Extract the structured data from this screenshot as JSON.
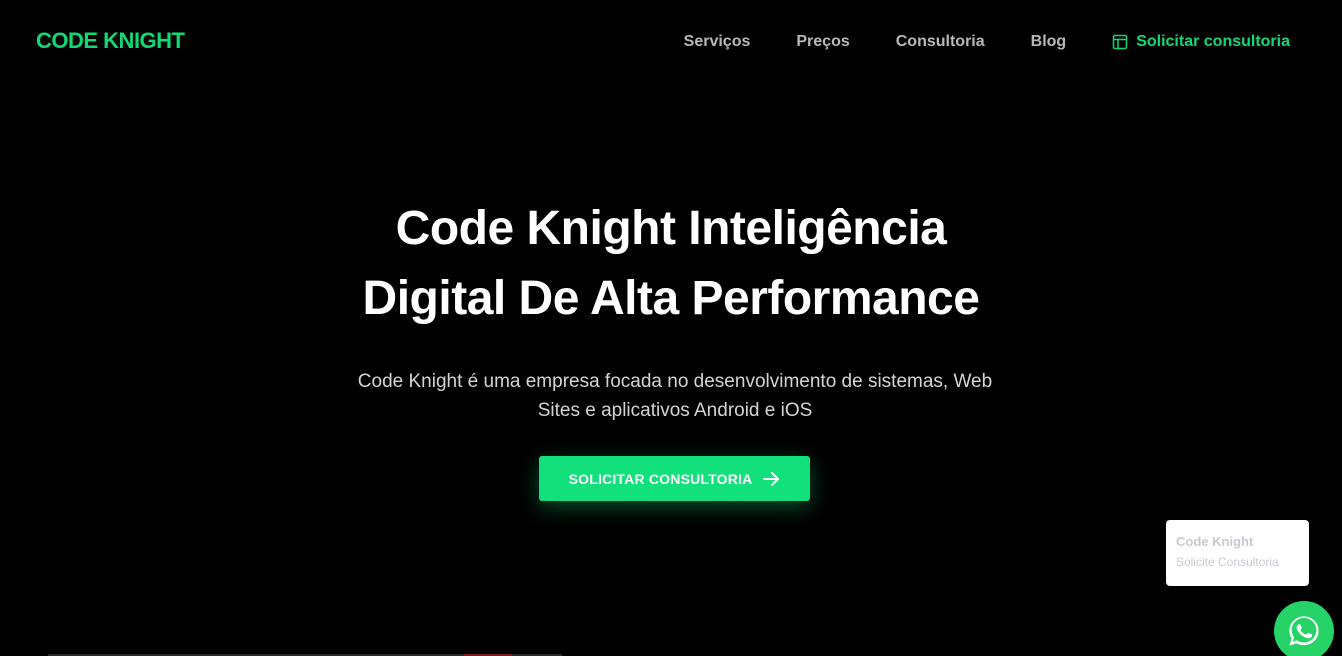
{
  "header": {
    "logo": "CODE KNIGHT",
    "nav": [
      {
        "label": "Serviços"
      },
      {
        "label": "Preços"
      },
      {
        "label": "Consultoria"
      },
      {
        "label": "Blog"
      }
    ],
    "cta": {
      "label": "Solicitar consultoria",
      "icon": "layout-icon"
    }
  },
  "hero": {
    "title_line1": "Code Knight Inteligência",
    "title_line2": "Digital De Alta Performance",
    "subtitle_line1": "Code Knight é uma empresa focada no desenvolvimento de sistemas, Web",
    "subtitle_line2": "Sites e aplicativos Android e iOS",
    "button": {
      "label": "SOLICITAR CONSULTORIA",
      "icon": "arrow-right-icon"
    }
  },
  "chat_widget": {
    "title": "Code Knight",
    "subtitle": "Solicite Consultoria",
    "icon": "whatsapp-icon"
  },
  "colors": {
    "background": "#000000",
    "accent": "#12d874",
    "button": "#12e07a",
    "whatsapp": "#25d366",
    "nav_text": "#b8b8b8",
    "title_text": "#ffffff"
  }
}
